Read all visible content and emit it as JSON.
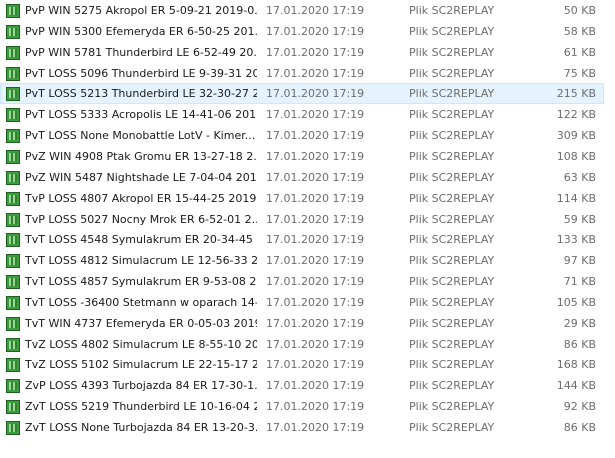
{
  "files": [
    {
      "name": "PvP WIN 5275 Akropol ER 5-09-21 2019-0...",
      "modified": "17.01.2020 17:19",
      "type": "Plik SC2REPLAY",
      "size": "50 KB",
      "icon": "sc2replay-file-icon",
      "selected": false
    },
    {
      "name": "PvP WIN 5300 Efemeryda ER 6-50-25 201...",
      "modified": "17.01.2020 17:19",
      "type": "Plik SC2REPLAY",
      "size": "58 KB",
      "icon": "sc2replay-file-icon",
      "selected": false
    },
    {
      "name": "PvP WIN 5781 Thunderbird LE 6-52-49 20...",
      "modified": "17.01.2020 17:19",
      "type": "Plik SC2REPLAY",
      "size": "61 KB",
      "icon": "sc2replay-file-icon",
      "selected": false
    },
    {
      "name": "PvT LOSS 5096 Thunderbird LE 9-39-31 20...",
      "modified": "17.01.2020 17:19",
      "type": "Plik SC2REPLAY",
      "size": "75 KB",
      "icon": "sc2replay-file-icon",
      "selected": false
    },
    {
      "name": "PvT LOSS 5213 Thunderbird LE 32-30-27 2...",
      "modified": "17.01.2020 17:19",
      "type": "Plik SC2REPLAY",
      "size": "215 KB",
      "icon": "sc2replay-file-icon",
      "selected": true
    },
    {
      "name": "PvT LOSS 5333 Acropolis LE 14-41-06 201...",
      "modified": "17.01.2020 17:19",
      "type": "Plik SC2REPLAY",
      "size": "122 KB",
      "icon": "sc2replay-file-icon",
      "selected": false
    },
    {
      "name": "PvT LOSS None Monobattle LotV - Kimer...",
      "modified": "17.01.2020 17:19",
      "type": "Plik SC2REPLAY",
      "size": "309 KB",
      "icon": "sc2replay-file-icon",
      "selected": false
    },
    {
      "name": "PvZ WIN 4908 Ptak Gromu ER 13-27-18 2...",
      "modified": "17.01.2020 17:19",
      "type": "Plik SC2REPLAY",
      "size": "108 KB",
      "icon": "sc2replay-file-icon",
      "selected": false
    },
    {
      "name": "PvZ WIN 5487 Nightshade LE 7-04-04 201...",
      "modified": "17.01.2020 17:19",
      "type": "Plik SC2REPLAY",
      "size": "63 KB",
      "icon": "sc2replay-file-icon",
      "selected": false
    },
    {
      "name": "TvP LOSS 4807 Akropol ER 15-44-25 2019-...",
      "modified": "17.01.2020 17:19",
      "type": "Plik SC2REPLAY",
      "size": "114 KB",
      "icon": "sc2replay-file-icon",
      "selected": false
    },
    {
      "name": "TvP LOSS 5027 Nocny Mrok ER 6-52-01 2...",
      "modified": "17.01.2020 17:19",
      "type": "Plik SC2REPLAY",
      "size": "59 KB",
      "icon": "sc2replay-file-icon",
      "selected": false
    },
    {
      "name": "TvT LOSS 4548 Symulakrum ER 20-34-45 ...",
      "modified": "17.01.2020 17:19",
      "type": "Plik SC2REPLAY",
      "size": "133 KB",
      "icon": "sc2replay-file-icon",
      "selected": false
    },
    {
      "name": "TvT LOSS 4812 Simulacrum LE 12-56-33 2...",
      "modified": "17.01.2020 17:19",
      "type": "Plik SC2REPLAY",
      "size": "97 KB",
      "icon": "sc2replay-file-icon",
      "selected": false
    },
    {
      "name": "TvT LOSS 4857 Symulakrum ER 9-53-08 2...",
      "modified": "17.01.2020 17:19",
      "type": "Plik SC2REPLAY",
      "size": "71 KB",
      "icon": "sc2replay-file-icon",
      "selected": false
    },
    {
      "name": "TvT LOSS -36400 Stetmann w oparach 14-...",
      "modified": "17.01.2020 17:19",
      "type": "Plik SC2REPLAY",
      "size": "105 KB",
      "icon": "sc2replay-file-icon",
      "selected": false
    },
    {
      "name": "TvT WIN 4737 Efemeryda ER 0-05-03 2019...",
      "modified": "17.01.2020 17:19",
      "type": "Plik SC2REPLAY",
      "size": "29 KB",
      "icon": "sc2replay-file-icon",
      "selected": false
    },
    {
      "name": "TvZ LOSS 4802 Simulacrum LE 8-55-10 20...",
      "modified": "17.01.2020 17:19",
      "type": "Plik SC2REPLAY",
      "size": "86 KB",
      "icon": "sc2replay-file-icon",
      "selected": false
    },
    {
      "name": "TvZ LOSS 5102 Simulacrum LE 22-15-17 2...",
      "modified": "17.01.2020 17:19",
      "type": "Plik SC2REPLAY",
      "size": "168 KB",
      "icon": "sc2replay-file-icon",
      "selected": false
    },
    {
      "name": "ZvP LOSS 4393 Turbojazda 84 ER 17-30-1...",
      "modified": "17.01.2020 17:19",
      "type": "Plik SC2REPLAY",
      "size": "144 KB",
      "icon": "sc2replay-file-icon",
      "selected": false
    },
    {
      "name": "ZvT LOSS 5219 Thunderbird LE 10-16-04 2...",
      "modified": "17.01.2020 17:19",
      "type": "Plik SC2REPLAY",
      "size": "92 KB",
      "icon": "sc2replay-file-icon",
      "selected": false
    },
    {
      "name": "ZvT LOSS None Turbojazda 84 ER 13-20-3...",
      "modified": "17.01.2020 17:19",
      "type": "Plik SC2REPLAY",
      "size": "86 KB",
      "icon": "sc2replay-file-icon",
      "selected": false
    }
  ],
  "colors": {
    "selected_background": "#e5f3ff",
    "selected_border": "#cce8ff",
    "icon_green": "#3e9b3e",
    "secondary_text": "#6d6d6d"
  }
}
